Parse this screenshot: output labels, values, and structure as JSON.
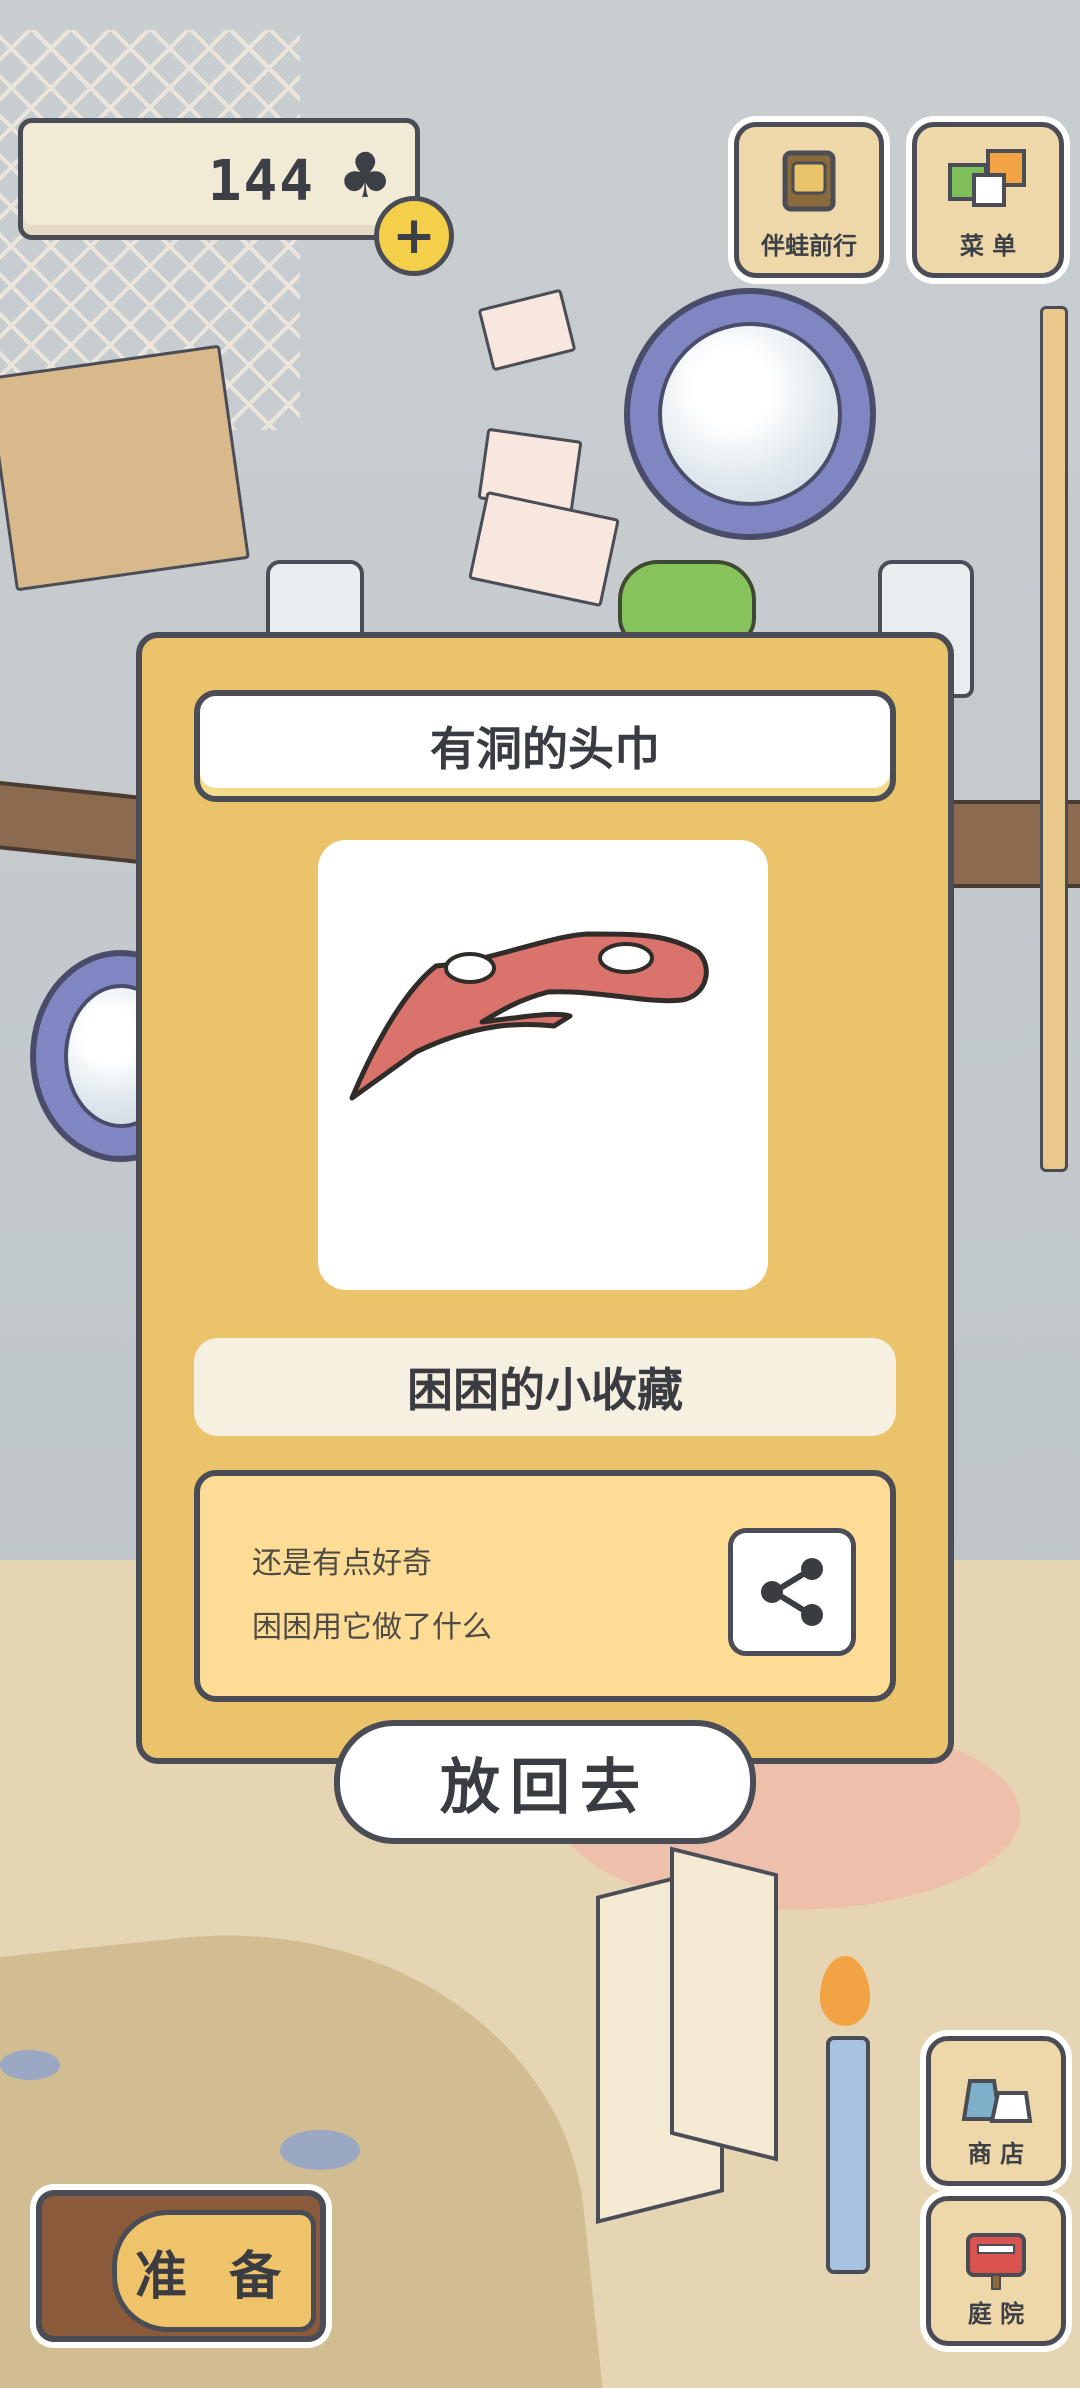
{
  "hud": {
    "clover_count": "144",
    "clover_icon": "clover-icon",
    "add_label": "+",
    "travel_label": "伴蛙前行",
    "menu_label": "菜 单",
    "shop_label": "商 店",
    "yard_label": "庭 院",
    "prepare_label": "准 备"
  },
  "item_card": {
    "title": "有洞的头巾",
    "item_icon": "red-hooded-bandana",
    "subtitle": "困困的小收藏",
    "description_lines": [
      "还是有点好奇",
      "困困用它做了什么"
    ],
    "share_icon": "share-icon",
    "return_label": "放回去"
  },
  "colors": {
    "card_bg": "#ebc36b",
    "title_bg": "#ffffff",
    "desc_bg": "#fddc95",
    "item_red": "#d9736c",
    "outline": "#4a4d55"
  }
}
